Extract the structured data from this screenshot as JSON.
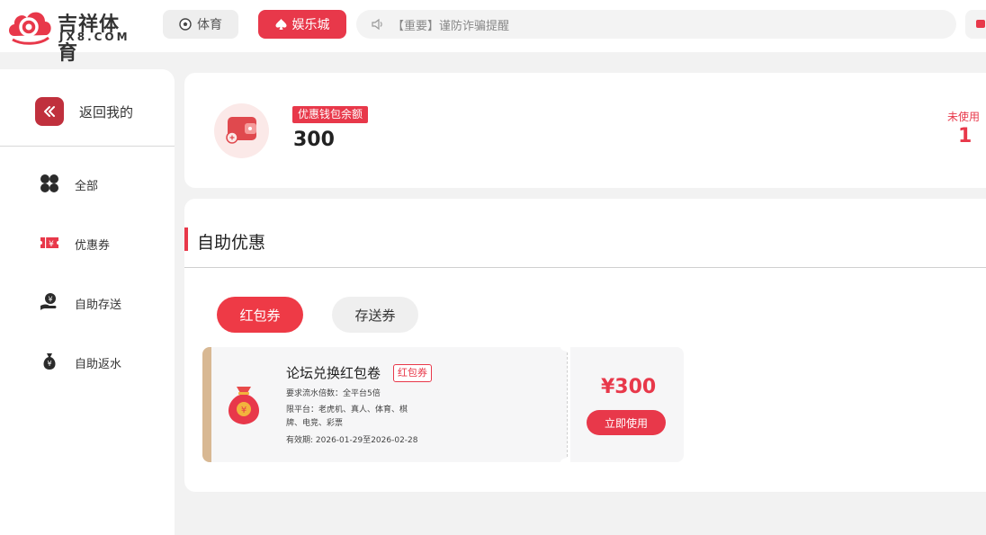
{
  "header": {
    "logo_cn": "吉祥体育",
    "logo_en": "JX8.COM",
    "nav": [
      {
        "label": "体育",
        "icon": "soccer-ball-icon"
      },
      {
        "label": "娱乐城",
        "icon": "spade-icon"
      }
    ],
    "notice": "【重要】谨防诈骗提醒"
  },
  "sidebar": {
    "back_label": "返回我的",
    "items": [
      {
        "label": "全部",
        "icon": "four-petal-icon"
      },
      {
        "label": "优惠券",
        "icon": "coupon-ticket-icon"
      },
      {
        "label": "自助存送",
        "icon": "hand-coin-icon"
      },
      {
        "label": "自助返水",
        "icon": "money-bag-icon"
      }
    ]
  },
  "balance": {
    "tag": "优惠钱包余额",
    "value": "300",
    "unused_label": "未使用",
    "unused_count": "1"
  },
  "self_service": {
    "title": "自助优惠",
    "tabs": [
      "红包券",
      "存送券"
    ],
    "coupon": {
      "title": "论坛兑换红包卷",
      "badge": "红包券",
      "turnover": "要求流水倍数：全平台5倍",
      "platform_line1": "限平台：老虎机、真人、体育、棋",
      "platform_line2": "牌、电竞、彩票",
      "validity": "有效期: 2026-01-29至2026-02-28",
      "amount": "¥300",
      "use_button": "立即使用"
    }
  },
  "colors": {
    "accent": "#e8384a",
    "accent_dark": "#c0303d",
    "coupon_strip": "#d8b893",
    "background": "#f2f2f2"
  }
}
